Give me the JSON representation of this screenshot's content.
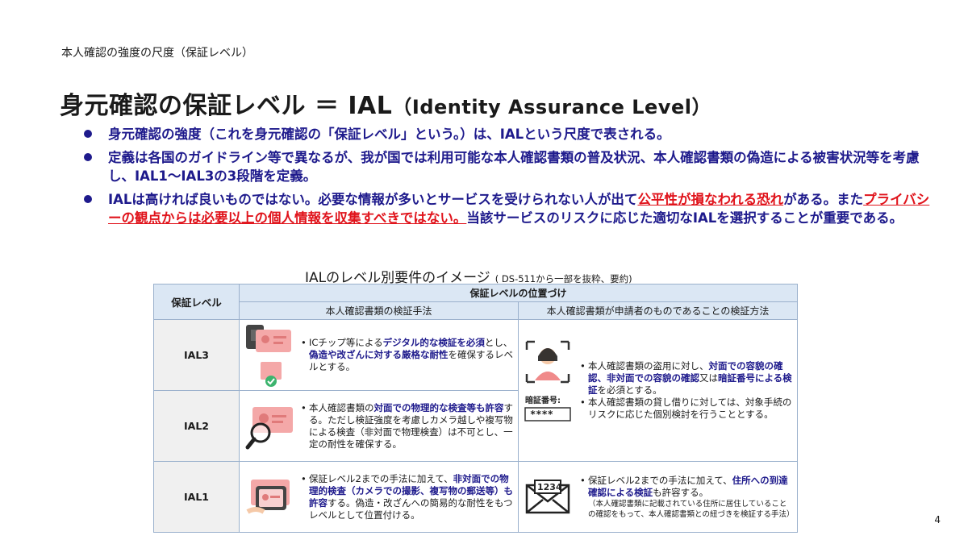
{
  "section_title": "本人確認の強度の尺度（保証レベル）",
  "heading": {
    "main": "身元確認の保証レベル ＝ IAL",
    "paren": "（Identity Assurance Level）"
  },
  "bullets": {
    "b1": "身元確認の強度（これを身元確認の「保証レベル」という。）は、IALという尺度で表される。",
    "b2": "定義は各国のガイドライン等で異なるが、我が国では利用可能な本人確認書類の普及状況、本人確認書類の偽造による被害状況等を考慮し、IAL1～IAL3の3段階を定義。",
    "b3a": "IALは高ければ良いものではない。必要な情報が多いとサービスを受けられない人が出て",
    "b3b": "公平性が損なわれる恐れ",
    "b3c": "がある。また",
    "b3d": "プライバシーの観点からは必要以上の個人情報を収集すべきではない。",
    "b3e": "当該サービスのリスクに応じた適切なIALを選択することが重要である。"
  },
  "table_title": {
    "main": "IALのレベル別要件のイメージ",
    "note": "( DS-511から一部を抜粋、要約)"
  },
  "table": {
    "col_level": "保証レベル",
    "col_group": "保証レベルの位置づけ",
    "col_a": "本人確認書類の検証手法",
    "col_b": "本人確認書類が申請者のものであることの検証方法",
    "rows": [
      {
        "level": "IAL3",
        "a1": "ICチップ等による",
        "a2": "デジタル的な検証を必須",
        "a3": "とし、",
        "a4": "偽造や改ざんに対する厳格な耐性",
        "a5": "を確保するレベルとする。",
        "b1": "本人確認書類の盗用に対し、",
        "b2": "対面での容貌の確認、非対面での容貌の確認",
        "b3": "又は",
        "b4": "暗証番号による検証",
        "b5": "を必須とする。",
        "b6": "本人確認書類の貸し借りに対しては、対象手続のリスクに応じた個別検討を行うこととする。",
        "pin_label": "暗証番号:",
        "pin_value": "****"
      },
      {
        "level": "IAL2",
        "a1": "本人確認書類の",
        "a2": "対面での物理的な検査等も許容",
        "a3": "する。ただし検証強度を考慮しカメラ越しや複写物による検査（非対面で物理検査）は不可とし、一定の耐性を確保する。"
      },
      {
        "level": "IAL1",
        "a1": "保証レベル2までの手法に加えて、",
        "a2": "非対面での物理的検査（カメラでの撮影、複写物の郵送等）も許容",
        "a3": "する。偽造・改ざんへの簡易的な耐性をもつレベルとして位置付ける。",
        "b1": "保証レベル2までの手法に加えて、",
        "b2": "住所への到達確認による検証",
        "b3": "も許容する。",
        "b4": "（本人確認書類に記載されている住所に居住していることの確認をもって、本人確認書類との紐づきを検証する手法）",
        "envelope_text": "1234"
      }
    ]
  },
  "page_number": "4",
  "colors": {
    "navy": "#1e1a8c",
    "red": "#e0131b",
    "header_blue": "#dbe7f4"
  }
}
